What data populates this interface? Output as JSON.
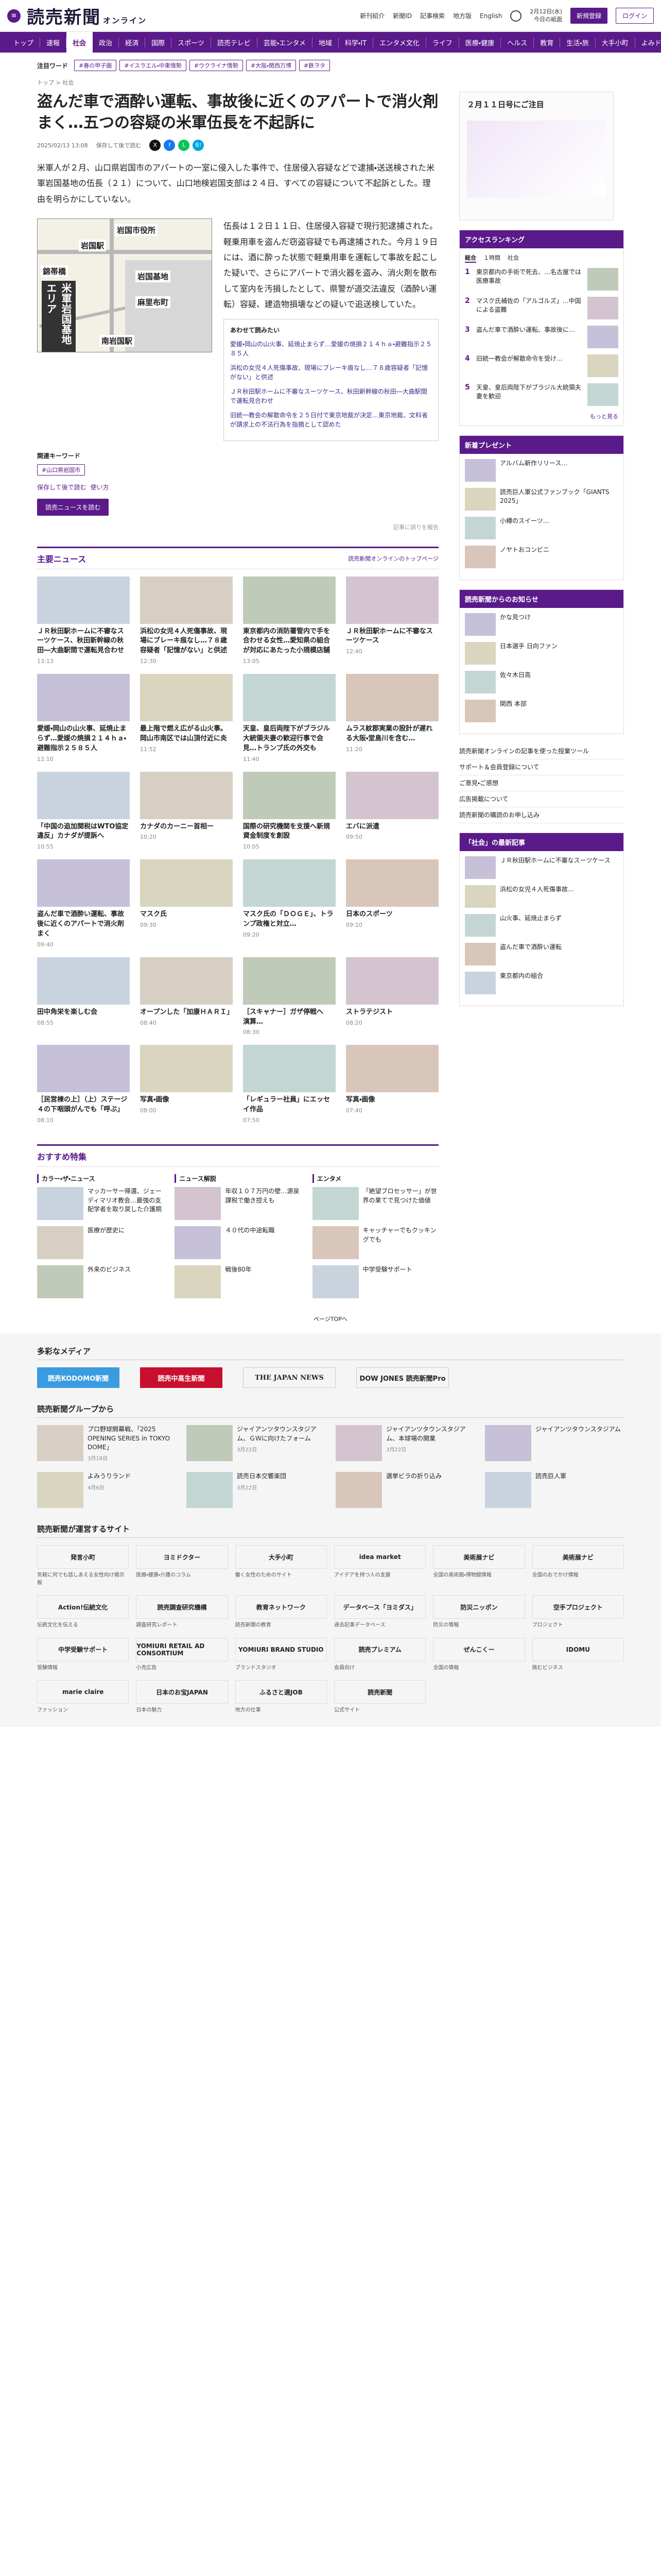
{
  "header": {
    "logo": "読売新聞",
    "logo_sub": "オンライン",
    "links": [
      "新刊紹介",
      "新聞ID",
      "記事検索",
      "地方版",
      "English"
    ],
    "date": "2月12日(水)",
    "date_sub": "今日の紙面",
    "subscribe": "新規登録",
    "login": "ログイン"
  },
  "gnav": [
    "トップ",
    "速報",
    "社会",
    "政治",
    "経済",
    "国際",
    "スポーツ",
    "読売テレビ",
    "芸能・エンタメ",
    "地域",
    "科学・IT",
    "エンタメ文化",
    "ライフ",
    "医療・健康",
    "ヘルス",
    "教育",
    "生活・旅",
    "大手小町",
    "よみドクター"
  ],
  "gnav_active": 2,
  "hot_label": "注目ワード",
  "hot_tags": [
    "#春の甲子園",
    "#イスラエル・中東情勢",
    "#ウクライナ情勢",
    "#大阪・関西万博",
    "#鉄ヲタ"
  ],
  "breadcrumb": "トップ > 社会",
  "article": {
    "title": "盗んだ車で酒酔い運転、事故後に近くのアパートで消火剤まく…五つの容疑の米軍伍長を不起訴に",
    "date": "2025/02/13 13:08",
    "share_label": "保存して後で読む",
    "lead": "米軍人が２月、山口県岩国市のアパートの一室に侵入した事件で、住居侵入容疑などで逮捕・送送検された米軍岩国基地の伍長（２１）について、山口地検岩国支部は２４日、すべての容疑について不起訴とした。理由を明らかにしていない。",
    "body": "伍長は１２日１１日、住居侵入容疑で現行犯逮捕された。軽乗用車を盗んだ窃盗容疑でも再逮捕された。今月１９日には、酒に酔った状態で軽乗用車を運転して事故を起こした疑いで、さらにアパートで消火器を盗み、消火剤を散布して室内を汚損したとして、県警が道交法違反（酒酔い運転）容疑、建造物損壊などの疑いで追送検していた。",
    "map": {
      "labels": [
        "岩国市役所",
        "錦帯橋",
        "岩国基地",
        "麻里布町",
        "岩国駅",
        "南岩国駅"
      ],
      "area_label": "米軍岩国基地エリア"
    },
    "related_title": "あわせて読みたい",
    "related": [
      "愛媛・岡山の山火事、延焼止まらず…愛媛の焼損２１４ｈａ・避難指示２５８５人",
      "浜松の女児４人死傷事故、現場にブレーキ痕なし…７８歳容疑者「記憶がない」と供述",
      "ＪＲ秋田駅ホームに不審なスーツケース、秋田新幹線の秋田―大曲駅間で運転見合わせ",
      "旧統一教会の解散命令を２５日付で東京地裁が決定…東京地裁、文科省が請求上の不法行為を指摘として認めた"
    ],
    "keyword_h": "関連キーワード",
    "keywords": [
      "#山口県岩国市"
    ],
    "action_1": "保存して後で読む",
    "action_2": "使い方",
    "subscribe_btn": "読売ニュースを読む",
    "report": "記事に誤りを報告"
  },
  "main_news": {
    "title": "主要ニュース",
    "more": "読売新聞オンラインのトップページ",
    "items": [
      {
        "t": "ＪＲ秋田駅ホームに不審なスーツケース、秋田新幹線の秋田―大曲駅間で運転見合わせ",
        "d": "13:13"
      },
      {
        "t": "浜松の女児４人死傷事故、現場にブレーキ痕なし…７８歳容疑者「記憶がない」と供述",
        "d": "12:30"
      },
      {
        "t": "東京都内の消防署管内で手を合わせる女性…愛知県の組合が対応にあたった小規模店舗",
        "d": "13:05"
      },
      {
        "t": "ＪＲ秋田駅ホームに不審なスーツケース",
        "d": "12:40"
      },
      {
        "t": "愛媛・岡山の山火事、延焼止まらず…愛媛の焼損２１４ｈａ・避難指示２５８５人",
        "d": "12:10"
      },
      {
        "t": "最上階で燃え広がる山火事。岡山市南区では山頂付近に炎",
        "d": "11:52"
      },
      {
        "t": "天皇、皇后両陛下がブラジル大統領夫妻の歓迎行事で会見…トランプ氏の外交も",
        "d": "11:40"
      },
      {
        "t": "ムラス紋郡実業の設計が遅れる大阪・堂島川を含む…",
        "d": "11:20"
      },
      {
        "t": "「中国の追加関税はWTO協定違反」カナダが提訴へ",
        "d": "10:55"
      },
      {
        "t": "カナダのカーニー首相ー",
        "d": "10:20"
      },
      {
        "t": "国際の研究機関を支援へ新規資金制度を創設",
        "d": "10:05"
      },
      {
        "t": "エバに派遣",
        "d": "09:50"
      },
      {
        "t": "盗んだ車で酒酔い運転、事故後に近くのアパートで消火剤まく",
        "d": "09:40"
      },
      {
        "t": "マスク氏",
        "d": "09:30"
      },
      {
        "t": "マスク氏の「ＤＯＧＥ」、トランプ政権と対立…",
        "d": "09:20"
      },
      {
        "t": "日本のスポーツ",
        "d": "09:10"
      },
      {
        "t": "田中角栄を楽しむ会",
        "d": "08:55"
      },
      {
        "t": "オープンした「加康ＨＡＲＩ」",
        "d": "08:40"
      },
      {
        "t": "［スキャナー］ガザ停戦へ　演算…",
        "d": "08:30"
      },
      {
        "t": "ストラテジスト",
        "d": "08:20"
      },
      {
        "t": "［民営棟の上］（上）ステージ４の下咽頭がんでも「呼ぶ」",
        "d": "08:10"
      },
      {
        "t": "写真・画像",
        "d": "08:00"
      },
      {
        "t": "「レギュラー社員」にエッセイ作品",
        "d": "07:50"
      },
      {
        "t": "写真・画像",
        "d": "07:40"
      }
    ]
  },
  "recommend": {
    "title": "おすすめ特集",
    "cols": [
      {
        "h": "カラー・ザ・ニュース",
        "items": [
          "マッカーサー帰還、ジェーディマリオ教会…最強の支配学者を取り戻した介護期",
          "医療が歴史に",
          "外来のビジネス"
        ]
      },
      {
        "h": "ニュース解説",
        "items": [
          "年収１０７万円の壁…源泉課税で働き控えも",
          "４０代の中途転職",
          "戦後80年"
        ]
      },
      {
        "h": "エンタメ",
        "items": [
          "「絶望ブロセッサー」が世界の果てで見つけた価値",
          "キャッチャーでもクッキングでも",
          "中学受験サポート"
        ]
      }
    ]
  },
  "pagetop": "ページTOPへ",
  "side": {
    "ad_title": "２月１１日号にご注目",
    "access_title": "アクセスランキング",
    "tabs": [
      "総合",
      "１時間",
      "社会"
    ],
    "ranks": [
      "東京都内の手術で死去、…名古屋では医療事故",
      "マスク氏補佐の「アルゴルズ」…中国による盗難",
      "盗んだ車で酒酔い運転、事故後に…",
      "旧統一教会が解散命令を受け…",
      "天皇、皇后両陛下がブラジル大統領夫妻を歓迎"
    ],
    "more": "もっと見る",
    "present_title": "新着プレゼント",
    "presents": [
      "アルバム新作リリース…",
      "読売巨人軍公式ファンブック「GIANTS 2025」",
      "小樽のスイーツ…",
      "ノヤトおコンビニ"
    ],
    "info_title": "読売新聞からのお知らせ",
    "infos": [
      "かな見つけ",
      "日本選手 日向ファン",
      "佐々木日高",
      "関西 本部"
    ],
    "links": [
      "読売新聞オンラインの記事を使った授業ツール",
      "サポート＆会員登録について",
      "ご意見・ご感想",
      "広告掲載について",
      "読売新聞の購読のお申し込み"
    ],
    "bulletin_title": "「社会」の最新記事",
    "bulletin": [
      "ＪＲ秋田駅ホームに不審なスーツケース",
      "浜松の女児４人死傷事故…",
      "山火事、延焼止まらず",
      "盗んだ車で酒酔い運転",
      "東京都内の組合"
    ]
  },
  "footer": {
    "media_title": "多彩なメディア",
    "media": [
      "読売KODOMO新聞",
      "読売中高生新聞",
      "THE JAPAN NEWS",
      "DOW JONES 読売新聞Pro"
    ],
    "group_title": "読売新聞グループから",
    "group": [
      {
        "t": "プロ野球開幕戦、「2025 OPENING SERIES in TOKYO DOME」",
        "d": "3月18日"
      },
      {
        "t": "ジャイアンツタウンスタジアム、ＧＷに向けたフォーム",
        "d": "3月22日"
      },
      {
        "t": "ジャイアンツタウンスタジアム、本球場の開業",
        "d": "3月22日"
      },
      {
        "t": "ジャイアンツタウンスタジアム",
        "d": ""
      },
      {
        "t": "よみうりランド",
        "d": "4月6日"
      },
      {
        "t": "読売日本交響楽団",
        "d": "3月22日"
      },
      {
        "t": "選挙ビラの折り込み",
        "d": ""
      },
      {
        "t": "読売巨人軍",
        "d": ""
      }
    ],
    "sites_title": "読売新聞が運営するサイト",
    "sites": [
      {
        "n": "発言小町",
        "x": "気軽に何でも話しあえる女性向け掲示板"
      },
      {
        "n": "ヨミドクター",
        "x": "医療・健康・介護のコラム"
      },
      {
        "n": "大手小町",
        "x": "働く女性のためのサイト"
      },
      {
        "n": "idea market",
        "x": "アイデアを持つ人の支援"
      },
      {
        "n": "美術展ナビ",
        "x": "全国の美術館・博物館情報"
      },
      {
        "n": "美術展ナビ",
        "x": "全国のおでかけ情報"
      },
      {
        "n": "Action!伝統文化",
        "x": "伝統文化を伝える"
      },
      {
        "n": "読売調査研究機構",
        "x": "調査研究レポート"
      },
      {
        "n": "教育ネットワーク",
        "x": "読売新聞の教育"
      },
      {
        "n": "データベース「ヨミダス」",
        "x": "過去記事データベース"
      },
      {
        "n": "防災ニッポン",
        "x": "防災の情報"
      },
      {
        "n": "空手プロジェクト",
        "x": "プロジェクト"
      },
      {
        "n": "中学受験サポート",
        "x": "受験情報"
      },
      {
        "n": "YOMIURI RETAIL AD CONSORTIUM",
        "x": "小売広告"
      },
      {
        "n": "YOMIURI BRAND STUDIO",
        "x": "ブランドスタジオ"
      },
      {
        "n": "読売プレミアム",
        "x": "会員向け"
      },
      {
        "n": "ぜんこくー",
        "x": "全国の情報"
      },
      {
        "n": "IDOMU",
        "x": "挑むビジネス"
      },
      {
        "n": "marie claire",
        "x": "ファッション"
      },
      {
        "n": "日本のお宝JAPAN",
        "x": "日本の魅力"
      },
      {
        "n": "ふるさと適JOB",
        "x": "地方の仕事"
      },
      {
        "n": "読売新聞",
        "x": "公式サイト"
      }
    ]
  },
  "colors": {
    "brand": "#5a1a8a",
    "accent": "#c8102e"
  }
}
